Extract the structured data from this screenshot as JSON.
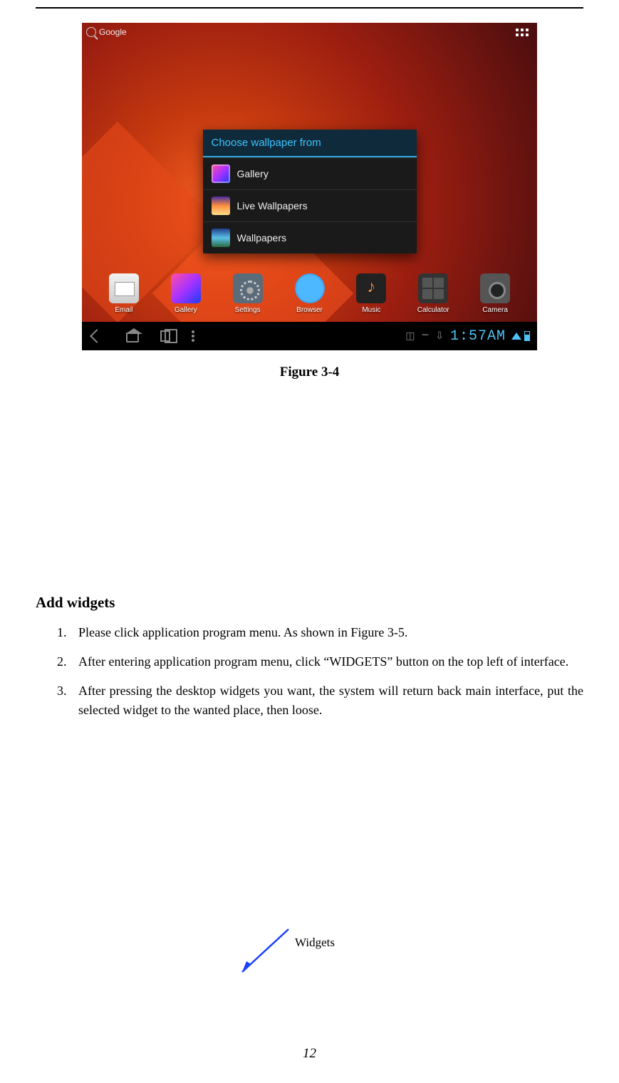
{
  "page_number": "12",
  "figure_caption": "Figure 3-4",
  "section_title": "Add widgets",
  "steps": [
    "Please click application program menu. As shown in Figure 3-5.",
    "After entering application program menu, click “WIDGETS” button on the top left of interface.",
    "After pressing the desktop widgets you want, the system will return back main interface, put the selected widget to the wanted place, then loose."
  ],
  "widgets_label": "Widgets",
  "screenshot": {
    "search": {
      "placeholder": "Google"
    },
    "dialog": {
      "title": "Choose wallpaper from",
      "items": [
        {
          "label": "Gallery"
        },
        {
          "label": "Live Wallpapers"
        },
        {
          "label": "Wallpapers"
        }
      ]
    },
    "dock": [
      {
        "label": "Email"
      },
      {
        "label": "Gallery"
      },
      {
        "label": "Settings"
      },
      {
        "label": "Browser"
      },
      {
        "label": "Music"
      },
      {
        "label": "Calculator"
      },
      {
        "label": "Camera"
      }
    ],
    "navbar": {
      "clock": "1:57AM"
    }
  }
}
